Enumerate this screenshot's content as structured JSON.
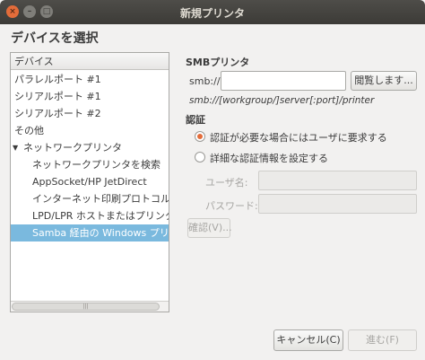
{
  "window": {
    "title": "新規プリンタ",
    "close_glyph": "×",
    "min_glyph": "–",
    "max_glyph": "□"
  },
  "heading": "デバイスを選択",
  "device_list": {
    "header": "デバイス",
    "items": [
      {
        "label": "パラレルポート #1"
      },
      {
        "label": "シリアルポート #1"
      },
      {
        "label": "シリアルポート #2"
      },
      {
        "label": "その他"
      },
      {
        "label": "ネットワークプリンタ"
      },
      {
        "label": "ネットワークプリンタを検索"
      },
      {
        "label": "AppSocket/HP JetDirect"
      },
      {
        "label": "インターネット印刷プロトコル (ip"
      },
      {
        "label": "LPD/LPR ホストまたはプリンター"
      },
      {
        "label": "Samba 経由の Windows プリンタ"
      }
    ],
    "expand_glyph": "▼",
    "scroll_grip": "|||"
  },
  "smb": {
    "section_title": "SMBプリンタ",
    "url_label": "smb://",
    "url_value": "",
    "browse_button": "閲覧します...",
    "hint": "smb://[workgroup/]server[:port]/printer"
  },
  "auth": {
    "section_title": "認証",
    "option_prompt": "認証が必要な場合にはユーザに要求する",
    "option_set": "詳細な認証情報を設定する",
    "username_label": "ユーザ名:",
    "password_label": "パスワード:",
    "verify_button": "確認(V)..."
  },
  "buttons": {
    "cancel": "キャンセル(C)",
    "forward": "進む(F)"
  }
}
